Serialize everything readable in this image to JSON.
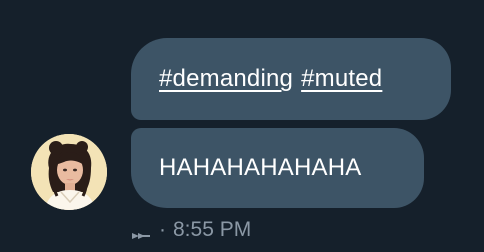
{
  "message": {
    "hashtags": [
      "#demanding",
      "#muted"
    ],
    "text": "HAHAHAHAHAHA"
  },
  "meta": {
    "status_icon": "sent-arrow-icon",
    "separator": "·",
    "time": "8:55 PM"
  },
  "avatar": {
    "icon": "user-avatar"
  },
  "colors": {
    "background": "#15202b",
    "bubble": "#3d5466",
    "text": "#ffffff",
    "meta_text": "#8b98a5"
  }
}
